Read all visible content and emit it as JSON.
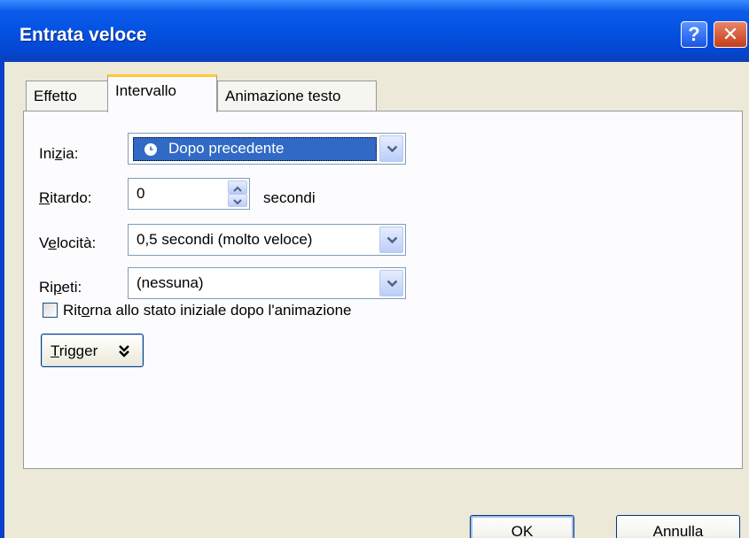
{
  "window": {
    "title": "Entrata veloce",
    "help_label": "?",
    "close_label": "✕"
  },
  "tabs": [
    {
      "label": "Effetto"
    },
    {
      "label": "Intervallo"
    },
    {
      "label": "Animazione testo"
    }
  ],
  "form": {
    "inizia": {
      "label_pre": "Ini",
      "label_u": "z",
      "label_post": "ia:",
      "value": "Dopo precedente"
    },
    "ritardo": {
      "label_u": "R",
      "label_post": "itardo:",
      "value": "0",
      "unit": "secondi"
    },
    "velocita": {
      "label_pre": "V",
      "label_u": "e",
      "label_post": "locità:",
      "value": "0,5 secondi (molto veloce)"
    },
    "ripeti": {
      "label_pre": "Ri",
      "label_u": "p",
      "label_post": "eti:",
      "value": "(nessuna)"
    },
    "ritorna": {
      "label_pre": "Rit",
      "label_u": "o",
      "label_post": "rna allo stato iniziale dopo l'animazione",
      "checked": false
    },
    "trigger": {
      "label_u": "T",
      "label_post": "rigger",
      "icon": "double-chevron-down-icon"
    }
  },
  "buttons": {
    "ok": "OK",
    "cancel": "Annulla"
  },
  "colors": {
    "titlebar": "#0553e3",
    "selection": "#316ac5",
    "dialog_bg": "#ece9d8"
  }
}
